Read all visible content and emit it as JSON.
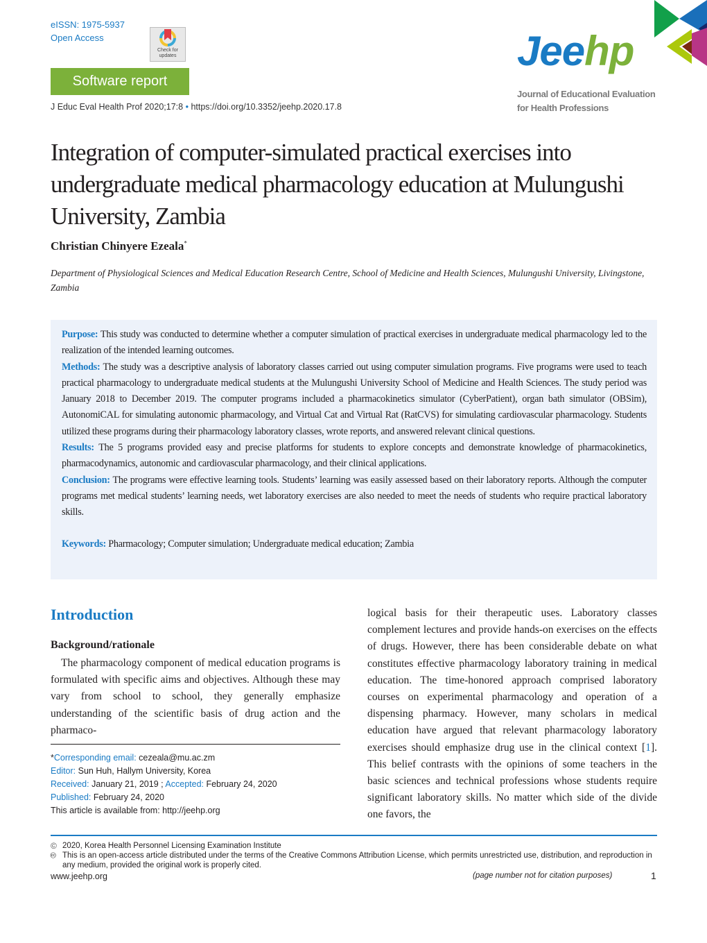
{
  "header": {
    "eissn": "eISSN: 1975-5937",
    "open_access": "Open Access",
    "crossmark_label": "Check for updates",
    "article_type": "Software report",
    "citation": "J Educ Eval Health Prof 2020;17:8",
    "bullet": "•",
    "doi": "https://doi.org/10.3352/jeehp.2020.17.8"
  },
  "logo": {
    "word_part1": "Jee",
    "word_part2": "hp",
    "subtitle_line1": "Journal of Educational Evaluation",
    "subtitle_line2": "for Health Professions",
    "colors": {
      "blue": "#1a7bc4",
      "green": "#7cb13a",
      "shape_green": "#12a04a",
      "shape_lime": "#acc80c",
      "shape_magenta": "#b83585",
      "shape_brown": "#7a2a10",
      "shape_navy": "#18286a"
    }
  },
  "article": {
    "title": "Integration of computer-simulated practical exercises into undergraduate medical pharmacology education at Mulungushi University, Zambia",
    "author": "Christian Chinyere Ezeala",
    "author_mark": "*",
    "affiliation": "Department of Physiological Sciences and Medical Education Research Centre, School of Medicine and Health Sciences, Mulungushi University, Livingstone, Zambia"
  },
  "abstract": {
    "purpose_label": "Purpose:",
    "purpose": " This study was conducted to determine whether a computer simulation of practical exercises in undergraduate medical pharmacology led to the realization of the intended learning outcomes.",
    "methods_label": "Methods:",
    "methods": " The study was a descriptive analysis of laboratory classes carried out using computer simulation programs. Five programs were used to teach practical pharmacology to undergraduate medical students at the Mulungushi University School of Medicine and Health Sciences. The study period was January 2018 to December 2019. The computer programs included a pharmacokinetics simulator (CyberPatient), organ bath simulator (OBSim), AutonomiCAL for simulating autonomic pharmacology, and Virtual Cat and Virtual Rat (RatCVS) for simulating cardiovascular pharmacology. Students utilized these programs during their pharmacology laboratory classes, wrote reports, and answered relevant clinical questions.",
    "results_label": "Results:",
    "results": " The 5 programs provided easy and precise platforms for students to explore concepts and demonstrate knowledge of pharmacokinetics, pharmacodynamics, autonomic and cardiovascular pharmacology, and their clinical applications.",
    "conclusion_label": "Conclusion:",
    "conclusion": " The programs were effective learning tools. Students’ learning was easily assessed based on their laboratory reports. Although the computer programs met medical students’ learning needs, wet laboratory exercises are also needed to meet the needs of students who require practical laboratory skills.",
    "keywords_label": "Keywords:",
    "keywords": " Pharmacology; Computer simulation; Undergraduate medical education; Zambia"
  },
  "body": {
    "section_heading": "Introduction",
    "subheading": "Background/rationale",
    "left_text": "The pharmacology component of medical education programs is formulated with specific aims and objectives. Although these may vary from school to school, they generally emphasize understanding of the scientific basis of drug action and the pharmaco-",
    "right_text_1": "logical basis for their therapeutic uses. Laboratory classes complement lectures and provide hands-on exercises on the effects of drugs. However, there has been considerable debate on what constitutes effective pharmacology laboratory training in medical education. The time-honored approach comprised laboratory courses on experimental pharmacology and operation of a dispensing pharmacy. However, many scholars in medical education have argued that relevant pharmacology laboratory exercises should emphasize drug use in the clinical context ",
    "right_ref_open": "[",
    "right_ref": "1",
    "right_ref_close": "]",
    "right_text_2": ". This belief contrasts with the opinions of some teachers in the basic sciences and technical professions whose students require significant laboratory skills. No matter which side of the divide one favors, the"
  },
  "footnotes": {
    "corr_star": "*",
    "corr_label": "Corresponding email:",
    "corr_value": " cezeala@mu.ac.zm",
    "editor_label": "Editor:",
    "editor_value": " Sun Huh, Hallym University, Korea",
    "received_label": "Received:",
    "received_value": " January 21, 2019 ; ",
    "accepted_label": "Accepted:",
    "accepted_value": " February 24, 2020",
    "published_label": "Published:",
    "published_value": " February 24, 2020",
    "available": "This article is available from: http://jeehp.org"
  },
  "footer": {
    "copyright_icon": "©",
    "copyright": "2020, Korea Health Personnel Licensing Examination Institute",
    "cc_icon": "🅭",
    "license": "This is an open-access article distributed under the terms of the Creative Commons Attribution License, which permits unrestricted use, distribution, and reproduction in any medium, provided the original work is properly cited.",
    "site": "www.jeehp.org",
    "page_note": "(page number not for citation purposes)",
    "page_number": "1"
  }
}
